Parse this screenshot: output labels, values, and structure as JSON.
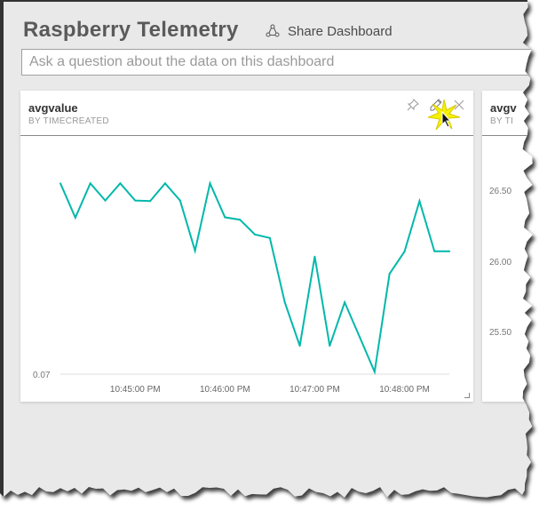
{
  "header": {
    "title": "Raspberry Telemetry",
    "share_label": "Share Dashboard",
    "share_icon": "share-icon"
  },
  "qa": {
    "placeholder": "Ask a question about the data on this dashboard"
  },
  "tiles": [
    {
      "title": "avgvalue",
      "subtitle": "BY TIMECREATED",
      "icons": [
        "pin-icon",
        "pencil-icon",
        "close-icon"
      ]
    },
    {
      "title": "avgv",
      "subtitle": "BY TI",
      "y_ticks": [
        "26.50",
        "26.00",
        "25.50"
      ]
    }
  ],
  "chart_data": {
    "type": "line",
    "title": "avgvalue",
    "subtitle": "BY TIMECREATED",
    "color": "#01b8aa",
    "x": [
      "10:44:10",
      "10:44:20",
      "10:44:30",
      "10:44:40",
      "10:44:50",
      "10:45:00",
      "10:45:10",
      "10:45:20",
      "10:45:30",
      "10:45:40",
      "10:45:50",
      "10:46:00",
      "10:46:10",
      "10:46:20",
      "10:46:30",
      "10:46:40",
      "10:46:50",
      "10:47:00",
      "10:47:10",
      "10:47:20",
      "10:47:30",
      "10:47:40",
      "10:47:50",
      "10:48:00",
      "10:48:10",
      "10:48:20",
      "10:48:30"
    ],
    "values": [
      0.716,
      0.6,
      0.716,
      0.658,
      0.716,
      0.658,
      0.656,
      0.716,
      0.658,
      0.488,
      0.716,
      0.601,
      0.593,
      0.543,
      0.531,
      0.313,
      0.166,
      0.468,
      0.166,
      0.313,
      0.196,
      0.078,
      0.41,
      0.485,
      0.656,
      0.486,
      0.486
    ],
    "x_ticks": [
      "10:45:00 PM",
      "10:46:00 PM",
      "10:47:00 PM",
      "10:48:00 PM"
    ],
    "x_tick_index": [
      5,
      11,
      17,
      23
    ],
    "y_ticks": [
      "0.07"
    ],
    "ylim": [
      0.07,
      0.72
    ],
    "grid": false
  }
}
